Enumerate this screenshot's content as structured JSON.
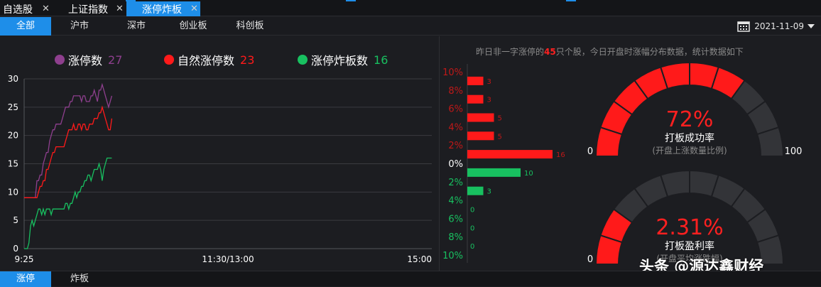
{
  "tabs": [
    {
      "label": "自选股",
      "close": "✕",
      "active": false
    },
    {
      "label": "上证指数",
      "close": "✕",
      "active": false
    },
    {
      "label": "涨停炸板",
      "close": "✕",
      "active": true
    }
  ],
  "subtabs": [
    {
      "label": "全部",
      "active": true
    },
    {
      "label": "沪市",
      "active": false
    },
    {
      "label": "深市",
      "active": false
    },
    {
      "label": "创业板",
      "active": false
    },
    {
      "label": "科创板",
      "active": false
    }
  ],
  "date": {
    "value": "2021-11-09",
    "icon": "calendar-icon"
  },
  "legend": [
    {
      "label": "涨停数",
      "value": "27",
      "color": "#8e3f8e"
    },
    {
      "label": "自然涨停数",
      "value": "23",
      "color": "#ff1a1a"
    },
    {
      "label": "涨停炸板数",
      "value": "16",
      "color": "#18c060"
    }
  ],
  "notice": {
    "prefix": "昨日非一字涨停的",
    "count": "45",
    "suffix": "只个股，今日开盘时涨幅分布数据，统计数据如下"
  },
  "gauges": [
    {
      "value_text": "72%",
      "value": 0.72,
      "title": "打板成功率",
      "subtitle": "(开盘上涨数量比例)",
      "min": "0",
      "max": "100"
    },
    {
      "value_text": "2.31%",
      "value": 0.23,
      "title": "打板盈利率",
      "subtitle": "(开盘平均涨跌幅)",
      "min": "0",
      "max": ""
    }
  ],
  "bottom_tabs": [
    {
      "label": "涨停",
      "active": true
    },
    {
      "label": "炸板",
      "active": false
    }
  ],
  "watermark": "头条 @源达鑫财经",
  "chart_data": [
    {
      "type": "line",
      "title": "",
      "xlabel": "",
      "ylabel": "",
      "x_ticks": [
        "9:25",
        "11:30/13:00",
        "15:00"
      ],
      "ylim": [
        0,
        30
      ],
      "y_ticks": [
        0,
        5,
        10,
        15,
        20,
        25,
        30
      ],
      "grid": true,
      "legend_position": "top",
      "series": [
        {
          "name": "涨停数",
          "color": "#8e3f8e",
          "values": [
            9,
            9,
            9,
            9,
            9,
            9,
            9,
            9,
            12,
            12,
            13,
            13,
            15,
            16,
            17,
            17,
            19,
            20,
            21,
            21,
            22,
            22,
            22,
            22,
            23,
            24,
            25,
            25,
            25,
            26,
            26,
            27,
            27,
            27,
            27,
            27,
            26,
            27,
            27,
            26,
            26,
            26,
            27,
            27,
            28,
            27,
            26,
            28,
            28,
            29,
            28,
            27,
            26,
            25,
            26,
            27
          ]
        },
        {
          "name": "自然涨停数",
          "color": "#ff1a1a",
          "values": [
            9,
            9,
            9,
            9,
            9,
            9,
            9,
            9,
            9,
            10,
            11,
            11,
            12,
            12,
            14,
            14,
            15,
            16,
            17,
            17,
            18,
            18,
            18,
            18,
            18,
            18,
            19,
            20,
            21,
            21,
            21,
            22,
            21,
            21,
            22,
            22,
            21,
            22,
            22,
            21,
            21,
            22,
            22,
            22,
            23,
            23,
            23,
            24,
            24,
            25,
            24,
            23,
            22,
            21,
            21,
            23
          ]
        },
        {
          "name": "涨停炸板数",
          "color": "#18c060",
          "values": [
            0,
            0,
            0,
            1,
            4,
            5,
            4,
            5,
            6,
            7,
            7,
            6,
            7,
            6,
            7,
            7,
            7,
            6,
            7,
            7,
            7,
            7,
            7,
            7,
            7,
            7,
            8,
            8,
            7,
            8,
            8,
            9,
            10,
            9,
            10,
            10,
            11,
            11,
            12,
            12,
            13,
            13,
            12,
            13,
            14,
            14,
            14,
            15,
            14,
            12,
            14,
            15,
            16,
            16,
            16,
            16
          ]
        }
      ]
    },
    {
      "type": "bar",
      "title": "",
      "orientation": "horizontal",
      "categories": [
        "10%",
        "8%",
        "6%",
        "4%",
        "2%",
        "0%",
        "2%",
        "4%",
        "6%",
        "8%",
        "10%"
      ],
      "values": [
        3,
        3,
        5,
        5,
        16,
        10,
        3,
        0,
        0,
        0
      ],
      "value_labels": [
        "3",
        "3",
        "5",
        "5",
        "16",
        "10",
        "3",
        "0",
        "0",
        "0"
      ],
      "colors": {
        "up": "#ff1a1a",
        "down": "#18c060",
        "flat": "#ffffff"
      }
    }
  ]
}
